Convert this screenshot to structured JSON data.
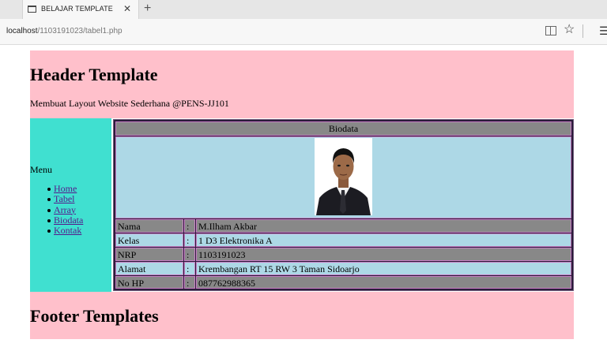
{
  "browser": {
    "tab_title": "BELAJAR TEMPLATE",
    "close_glyph": "✕",
    "new_tab_glyph": "+",
    "url_host": "localhost",
    "url_path": "/1103191023/tabel1.php",
    "star_glyph": "☆",
    "menu_glyph": "☰"
  },
  "header": {
    "title": "Header Template",
    "subtitle": "Membuat Layout Website Sederhana @PENS-JJ101"
  },
  "sidebar": {
    "menu_label": "Menu",
    "items": [
      {
        "label": "Home"
      },
      {
        "label": "Tabel"
      },
      {
        "label": "Array"
      },
      {
        "label": "Biodata"
      },
      {
        "label": "Kontak"
      }
    ]
  },
  "biodata": {
    "title": "Biodata",
    "separator": ":",
    "rows": [
      {
        "label": "Nama",
        "value": "M.Ilham Akbar"
      },
      {
        "label": "Kelas",
        "value": "1 D3 Elektronika A"
      },
      {
        "label": "NRP",
        "value": "1103191023"
      },
      {
        "label": "Alamat",
        "value": "Krembangan RT 15 RW 3 Taman Sidoarjo"
      },
      {
        "label": "No HP",
        "value": "087762988365"
      }
    ]
  },
  "footer": {
    "title": "Footer Templates"
  },
  "colors": {
    "header_bg": "#ffc0cb",
    "sidebar_bg": "#40e0d0",
    "row_gray": "#888888",
    "row_blue": "#add8e6",
    "link": "#551a8b"
  }
}
